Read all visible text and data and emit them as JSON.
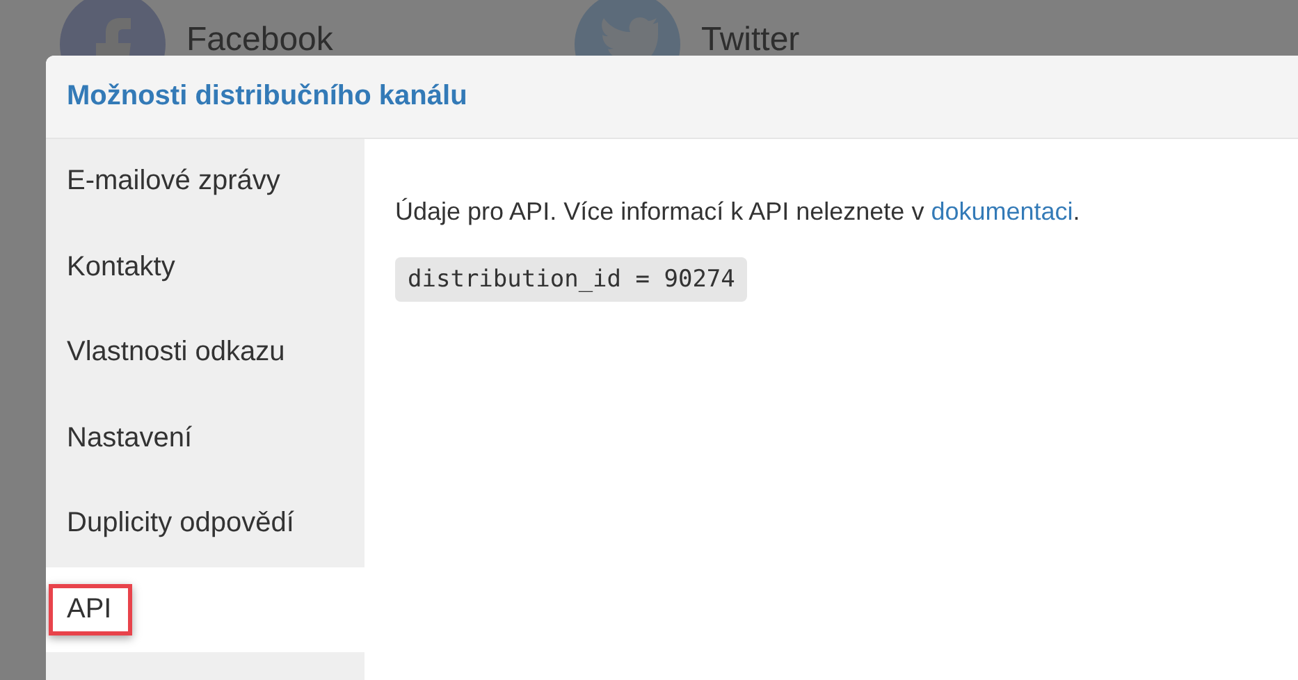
{
  "background_links": [
    {
      "kind": "facebook",
      "label": "Facebook"
    },
    {
      "kind": "twitter",
      "label": "Twitter"
    }
  ],
  "dialog": {
    "title": "Možnosti distribučního kanálu",
    "sidebar": {
      "items": [
        {
          "label": "E-mailové zprávy",
          "selected": false,
          "highlighted": false
        },
        {
          "label": "Kontakty",
          "selected": false,
          "highlighted": false
        },
        {
          "label": "Vlastnosti odkazu",
          "selected": false,
          "highlighted": false
        },
        {
          "label": "Nastavení",
          "selected": false,
          "highlighted": false
        },
        {
          "label": "Duplicity odpovědí",
          "selected": false,
          "highlighted": false
        },
        {
          "label": "API",
          "selected": true,
          "highlighted": true
        }
      ]
    },
    "content": {
      "text": "Údaje pro API. Více informací k API neleznete v",
      "link": "dokumentaci",
      "after_link": ".",
      "code": "distribution_id = 90274"
    }
  }
}
